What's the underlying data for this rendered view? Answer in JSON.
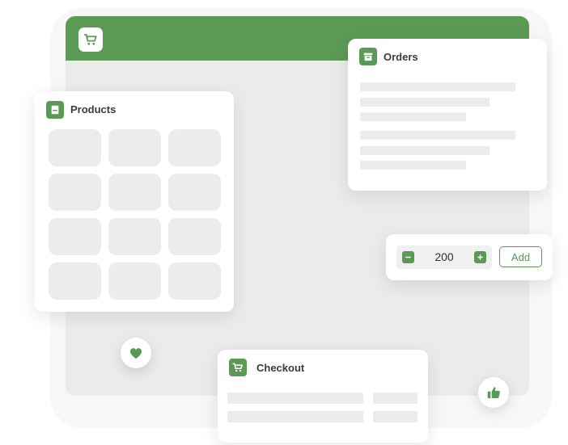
{
  "products": {
    "title": "Products",
    "tile_count": 12
  },
  "orders": {
    "title": "Orders"
  },
  "quantity": {
    "value": "200",
    "add_label": "Add"
  },
  "checkout": {
    "title": "Checkout"
  },
  "icons": {
    "header": "cart-icon",
    "products": "product-card-icon",
    "orders": "archive-box-icon",
    "checkout": "cart-icon",
    "favorite": "heart-icon",
    "like": "thumbs-up-icon",
    "decrement": "minus-icon",
    "increment": "plus-icon"
  },
  "colors": {
    "accent": "#5a9a55",
    "window_bg": "#ebebeb",
    "card_bg": "#ffffff",
    "placeholder": "#ececec",
    "title_text": "#3b3b3b"
  }
}
